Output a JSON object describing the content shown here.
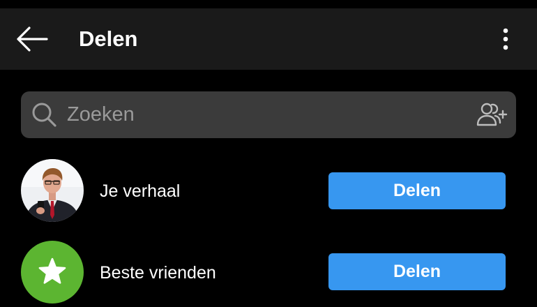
{
  "header": {
    "title": "Delen",
    "back_icon": "arrow-left-icon",
    "menu_icon": "more-vertical-icon"
  },
  "search": {
    "placeholder": "Zoeken",
    "value": "",
    "search_icon": "search-icon",
    "add_people_icon": "add-people-icon"
  },
  "share_targets": [
    {
      "label": "Je verhaal",
      "avatar": "profile-photo",
      "button_label": "Delen"
    },
    {
      "label": "Beste vrienden",
      "avatar": "star-icon",
      "avatar_color": "#5cb531",
      "button_label": "Delen"
    }
  ],
  "colors": {
    "background": "#000000",
    "app_bar": "#1a1a1a",
    "search_field": "#3b3b3b",
    "placeholder": "#9a9a9a",
    "accent_button": "#3797f0",
    "close_friends_green": "#5cb531"
  }
}
